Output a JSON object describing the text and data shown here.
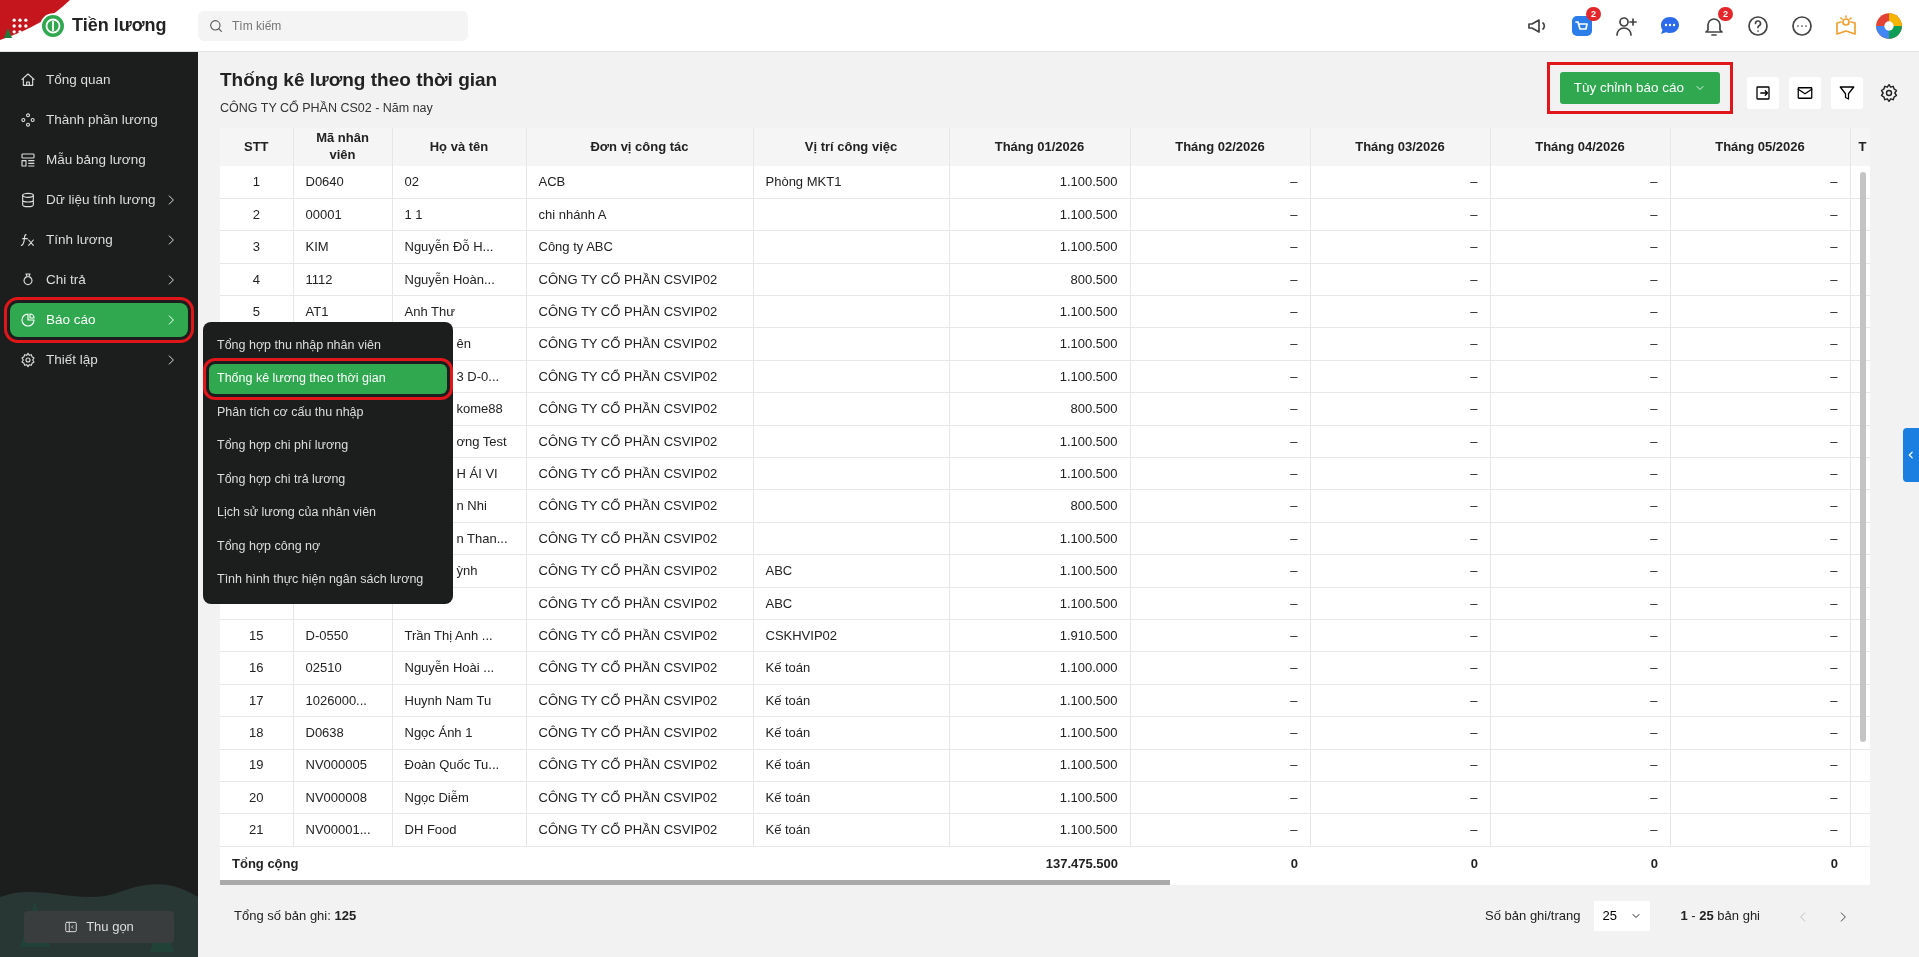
{
  "header": {
    "app_title": "Tiền lương",
    "search": {
      "placeholder": "Tìm kiếm"
    },
    "cart_badge": "2",
    "bell_badge": "2"
  },
  "sidebar": {
    "items": [
      {
        "label": "Tổng quan",
        "has_submenu": false,
        "selected": false,
        "highlighted": false
      },
      {
        "label": "Thành phần lương",
        "has_submenu": false,
        "selected": false,
        "highlighted": false
      },
      {
        "label": "Mẫu bảng lương",
        "has_submenu": false,
        "selected": false,
        "highlighted": false
      },
      {
        "label": "Dữ liệu tính lương",
        "has_submenu": true,
        "selected": false,
        "highlighted": false
      },
      {
        "label": "Tính lương",
        "has_submenu": true,
        "selected": false,
        "highlighted": false
      },
      {
        "label": "Chi trả",
        "has_submenu": true,
        "selected": false,
        "highlighted": false
      },
      {
        "label": "Báo cáo",
        "has_submenu": true,
        "selected": true,
        "highlighted": true
      },
      {
        "label": "Thiết lập",
        "has_submenu": true,
        "selected": false,
        "highlighted": false
      }
    ],
    "collapse_button": "Thu gọn"
  },
  "submenu": {
    "items": [
      {
        "label": "Tổng hợp thu nhập nhân viên",
        "selected": false,
        "highlighted": false
      },
      {
        "label": "Thống kê lương theo thời gian",
        "selected": true,
        "highlighted": true
      },
      {
        "label": "Phân tích cơ cấu thu nhập",
        "selected": false,
        "highlighted": false
      },
      {
        "label": "Tổng hợp chi phí lương",
        "selected": false,
        "highlighted": false
      },
      {
        "label": "Tổng hợp chi trả lương",
        "selected": false,
        "highlighted": false
      },
      {
        "label": "Lịch sử lương của nhân viên",
        "selected": false,
        "highlighted": false
      },
      {
        "label": "Tổng hợp công nợ",
        "selected": false,
        "highlighted": false
      },
      {
        "label": "Tình hình thực hiện ngân sách lương",
        "selected": false,
        "highlighted": false
      }
    ]
  },
  "page": {
    "title": "Thống kê lương theo thời gian",
    "subtitle": "CÔNG TY CỔ PHẦN CS02 - Năm nay",
    "customize_button": {
      "label": "Tùy chỉnh báo cáo",
      "highlighted": true
    }
  },
  "table": {
    "columns": [
      "STT",
      "Mã nhân viên",
      "Họ và tên",
      "Đơn vị công tác",
      "Vị trí công việc",
      "Tháng 01/2026",
      "Tháng 02/2026",
      "Tháng 03/2026",
      "Tháng 04/2026",
      "Tháng 05/2026",
      "T"
    ],
    "rows": [
      {
        "stt": "1",
        "code": "D0640",
        "name": "02",
        "unit": "ACB",
        "position": "Phòng MKT1",
        "months": [
          "1.100.500",
          "–",
          "–",
          "–",
          "–"
        ]
      },
      {
        "stt": "2",
        "code": "00001",
        "name": "1 1",
        "unit": "chi nhánh A",
        "months": [
          "1.100.500",
          "–",
          "–",
          "–",
          "–"
        ]
      },
      {
        "stt": "3",
        "code": "KIM",
        "name": "Nguyễn Đỗ H...",
        "unit": "Công ty ABC",
        "months": [
          "1.100.500",
          "–",
          "–",
          "–",
          "–"
        ]
      },
      {
        "stt": "4",
        "code": "1112",
        "name": "Nguyễn Hoàn...",
        "unit": "CÔNG TY CỔ PHẦN CSVIP02",
        "months": [
          "800.500",
          "–",
          "–",
          "–",
          "–"
        ]
      },
      {
        "stt": "5",
        "code": "AT1",
        "name": "Anh Thư",
        "unit": "CÔNG TY CỔ PHẦN CSVIP02",
        "months": [
          "1.100.500",
          "–",
          "–",
          "–",
          "–"
        ]
      },
      {
        "name": "ên",
        "unit": "CÔNG TY CỔ PHẦN CSVIP02",
        "months": [
          "1.100.500",
          "–",
          "–",
          "–",
          "–"
        ]
      },
      {
        "name": "3 D-0...",
        "unit": "CÔNG TY CỔ PHẦN CSVIP02",
        "months": [
          "1.100.500",
          "–",
          "–",
          "–",
          "–"
        ]
      },
      {
        "name": "kome88",
        "unit": "CÔNG TY CỔ PHẦN CSVIP02",
        "months": [
          "800.500",
          "–",
          "–",
          "–",
          "–"
        ]
      },
      {
        "name": "ơng Test",
        "unit": "CÔNG TY CỔ PHẦN CSVIP02",
        "months": [
          "1.100.500",
          "–",
          "–",
          "–",
          "–"
        ]
      },
      {
        "name": "H ÁI VI",
        "unit": "CÔNG TY CỔ PHẦN CSVIP02",
        "months": [
          "1.100.500",
          "–",
          "–",
          "–",
          "–"
        ]
      },
      {
        "name": "n Nhi",
        "unit": "CÔNG TY CỔ PHẦN CSVIP02",
        "months": [
          "800.500",
          "–",
          "–",
          "–",
          "–"
        ]
      },
      {
        "name": "n Than...",
        "unit": "CÔNG TY CỔ PHẦN CSVIP02",
        "months": [
          "1.100.500",
          "–",
          "–",
          "–",
          "–"
        ]
      },
      {
        "name": "ỳnh",
        "unit": "CÔNG TY CỔ PHẦN CSVIP02",
        "position": "ABC",
        "months": [
          "1.100.500",
          "–",
          "–",
          "–",
          "–"
        ]
      },
      {
        "unit": "CÔNG TY CỔ PHẦN CSVIP02",
        "position": "ABC",
        "months": [
          "1.100.500",
          "–",
          "–",
          "–",
          "–"
        ]
      },
      {
        "stt": "15",
        "code": "D-0550",
        "name": "Trần Thị Anh ...",
        "unit": "CÔNG TY CỔ PHẦN CSVIP02",
        "position": "CSKHVIP02",
        "months": [
          "1.910.500",
          "–",
          "–",
          "–",
          "–"
        ]
      },
      {
        "stt": "16",
        "code": "02510",
        "name": "Nguyễn Hoài ...",
        "unit": "CÔNG TY CỔ PHẦN CSVIP02",
        "position": "Kế toán",
        "months": [
          "1.100.000",
          "–",
          "–",
          "–",
          "–"
        ]
      },
      {
        "stt": "17",
        "code": "1026000...",
        "name": "Huynh Nam Tu",
        "unit": "CÔNG TY CỔ PHẦN CSVIP02",
        "position": "Kế toán",
        "months": [
          "1.100.500",
          "–",
          "–",
          "–",
          "–"
        ]
      },
      {
        "stt": "18",
        "code": "D0638",
        "name": "Ngọc Ánh 1",
        "unit": "CÔNG TY CỔ PHẦN CSVIP02",
        "position": "Kế toán",
        "months": [
          "1.100.500",
          "–",
          "–",
          "–",
          "–"
        ]
      },
      {
        "stt": "19",
        "code": "NV000005",
        "name": "Đoàn Quốc Tu...",
        "unit": "CÔNG TY CỔ PHẦN CSVIP02",
        "position": "Kế toán",
        "months": [
          "1.100.500",
          "–",
          "–",
          "–",
          "–"
        ]
      },
      {
        "stt": "20",
        "code": "NV000008",
        "name": "Ngọc Diễm",
        "unit": "CÔNG TY CỔ PHẦN CSVIP02",
        "position": "Kế toán",
        "months": [
          "1.100.500",
          "–",
          "–",
          "–",
          "–"
        ]
      },
      {
        "stt": "21",
        "code": "NV00001...",
        "name": "DH Food",
        "unit": "CÔNG TY CỔ PHẦN CSVIP02",
        "position": "Kế toán",
        "months": [
          "1.100.500",
          "–",
          "–",
          "–",
          "–"
        ]
      }
    ],
    "totals": {
      "label": "Tổng cộng",
      "months": [
        "137.475.500",
        "0",
        "0",
        "0",
        "0"
      ]
    }
  },
  "pagination": {
    "total_label": "Tổng số bản ghi:",
    "total": "125",
    "per_page_label": "Số bản ghi/trang",
    "per_page": "25",
    "range_from": "1",
    "range_sep": "-",
    "range_to": "25",
    "range_suffix": "bản ghi",
    "prev_disabled": true,
    "next_disabled": false
  }
}
